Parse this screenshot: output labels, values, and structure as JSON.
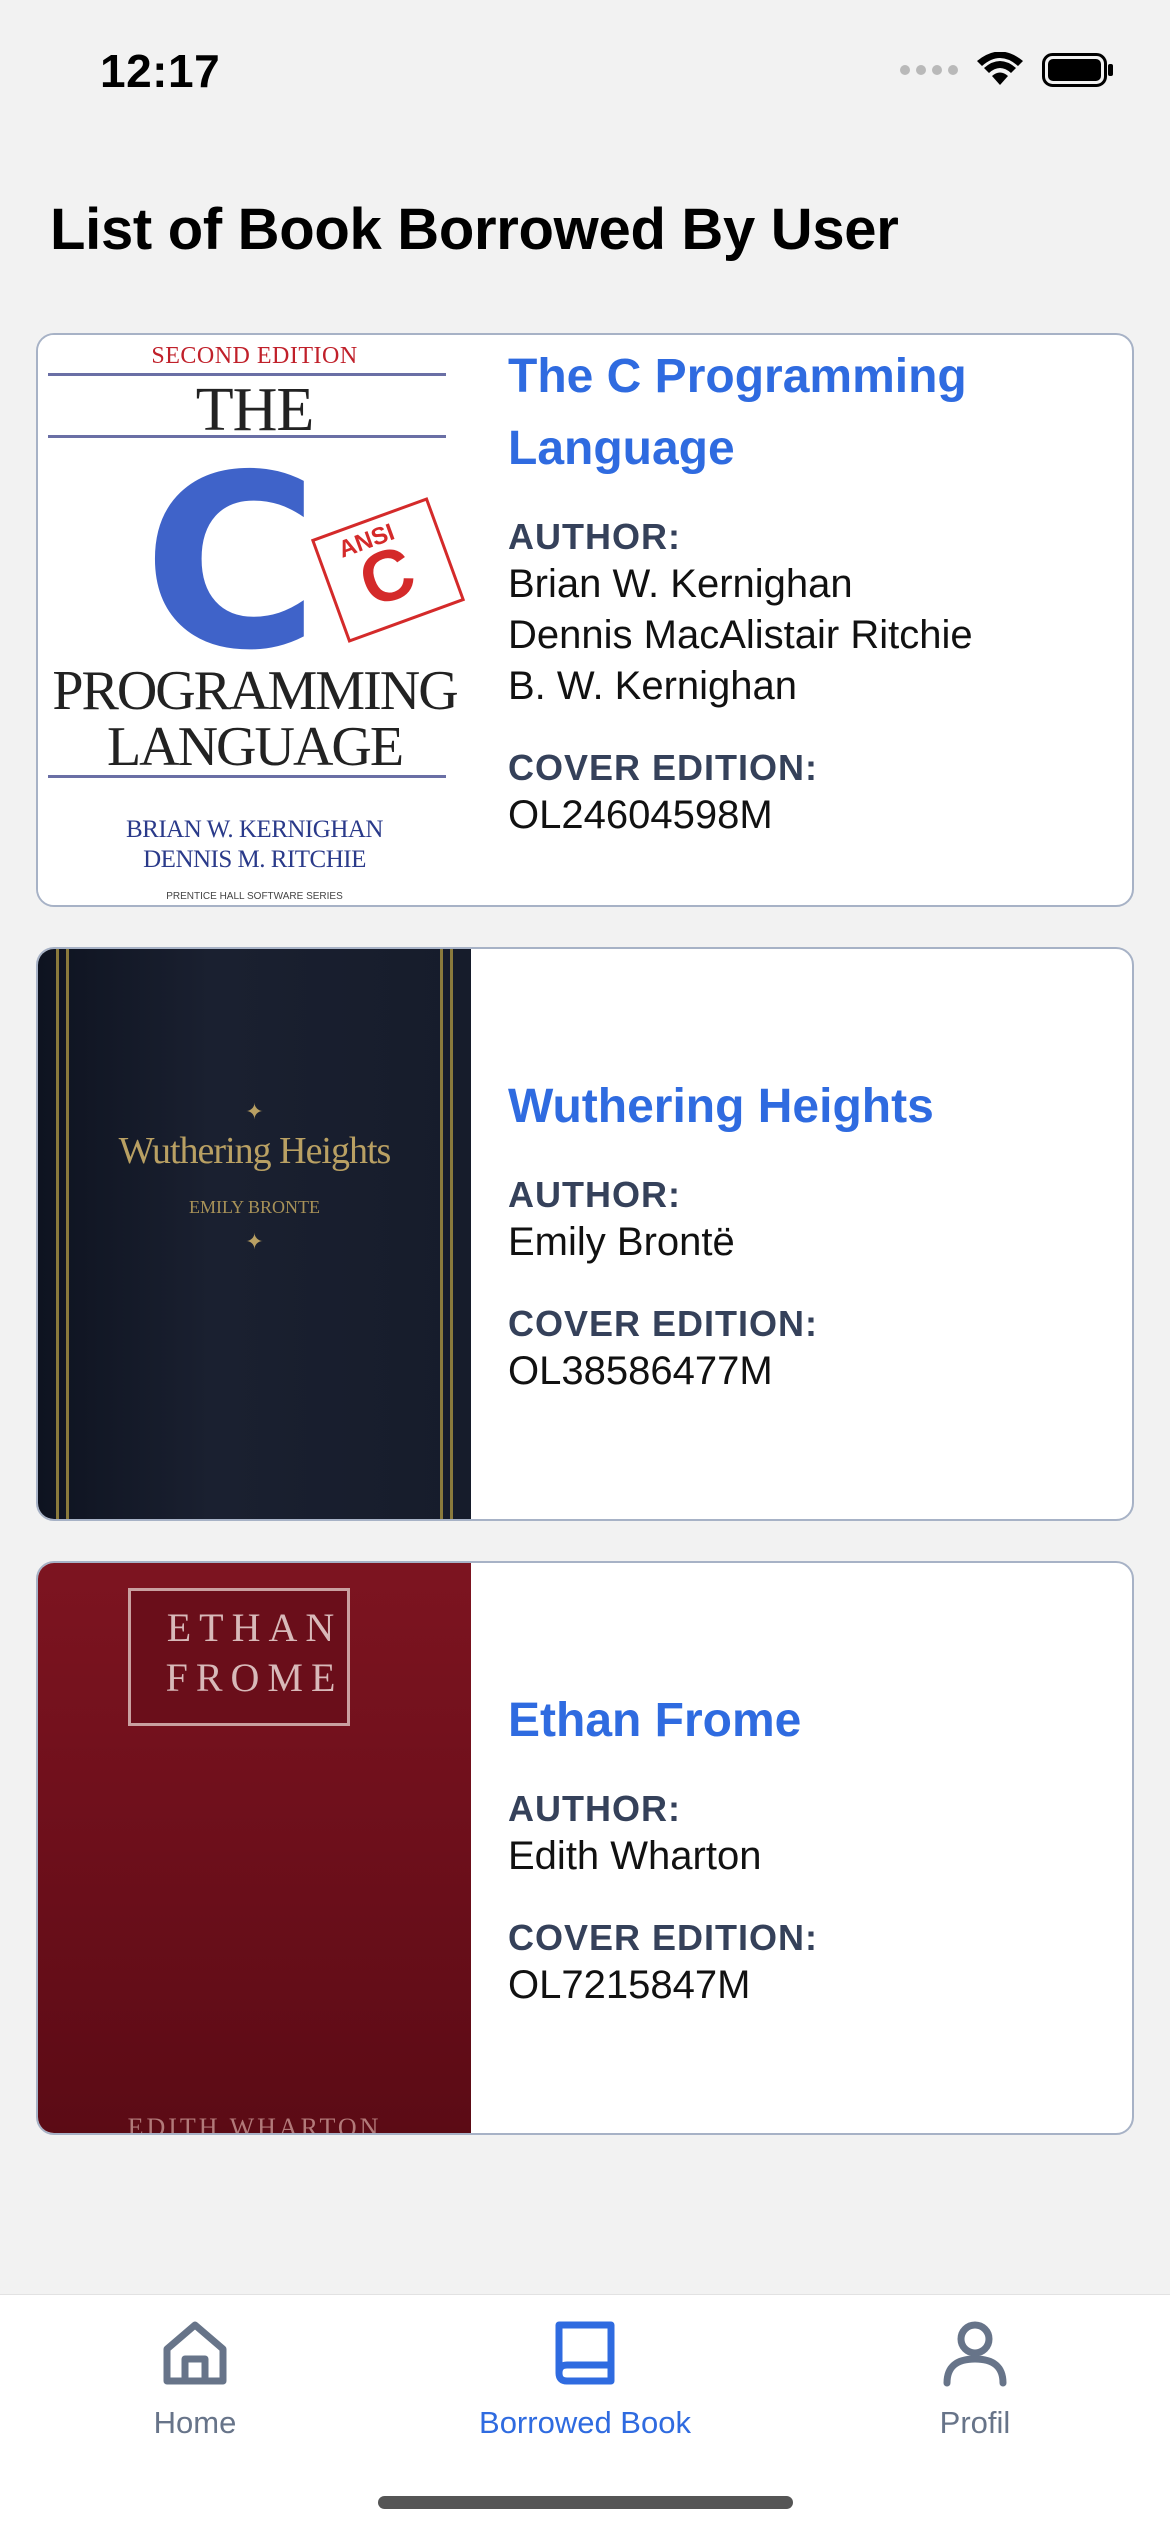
{
  "status_bar": {
    "time": "12:17"
  },
  "page": {
    "title": "List of Book Borrowed By User"
  },
  "labels": {
    "author": "AUTHOR:",
    "cover_edition": "COVER EDITION:"
  },
  "books": [
    {
      "title": "The C Programming Language",
      "authors": [
        "Brian W. Kernighan",
        "Dennis MacAlistair Ritchie",
        "B. W. Kernighan"
      ],
      "cover_edition": "OL24604598M",
      "cover": {
        "edition": "SECOND EDITION",
        "the": "THE",
        "letter": "C",
        "badge_top": "ANSI",
        "badge_letter": "C",
        "line1": "PROGRAMMING",
        "line2": "LANGUAGE",
        "author1": "BRIAN W. KERNIGHAN",
        "author2": "DENNIS M. RITCHIE",
        "series": "PRENTICE HALL SOFTWARE SERIES"
      }
    },
    {
      "title": "Wuthering Heights",
      "authors": [
        "Emily Brontë"
      ],
      "cover_edition": "OL38586477M",
      "cover": {
        "title": "Wuthering Heights",
        "author": "EMILY BRONTE"
      }
    },
    {
      "title": "Ethan Frome",
      "authors": [
        "Edith Wharton"
      ],
      "cover_edition": "OL7215847M",
      "cover": {
        "line1": "ETHAN",
        "line2": "FROME",
        "foot": "EDITH WHARTON"
      }
    }
  ],
  "tab_bar": {
    "items": [
      {
        "label": "Home",
        "icon": "home-icon"
      },
      {
        "label": "Borrowed Book",
        "icon": "book-icon",
        "active": true
      },
      {
        "label": "Profil",
        "icon": "user-icon"
      }
    ],
    "colors": {
      "active": "#2f6be0",
      "inactive": "#677489"
    }
  }
}
